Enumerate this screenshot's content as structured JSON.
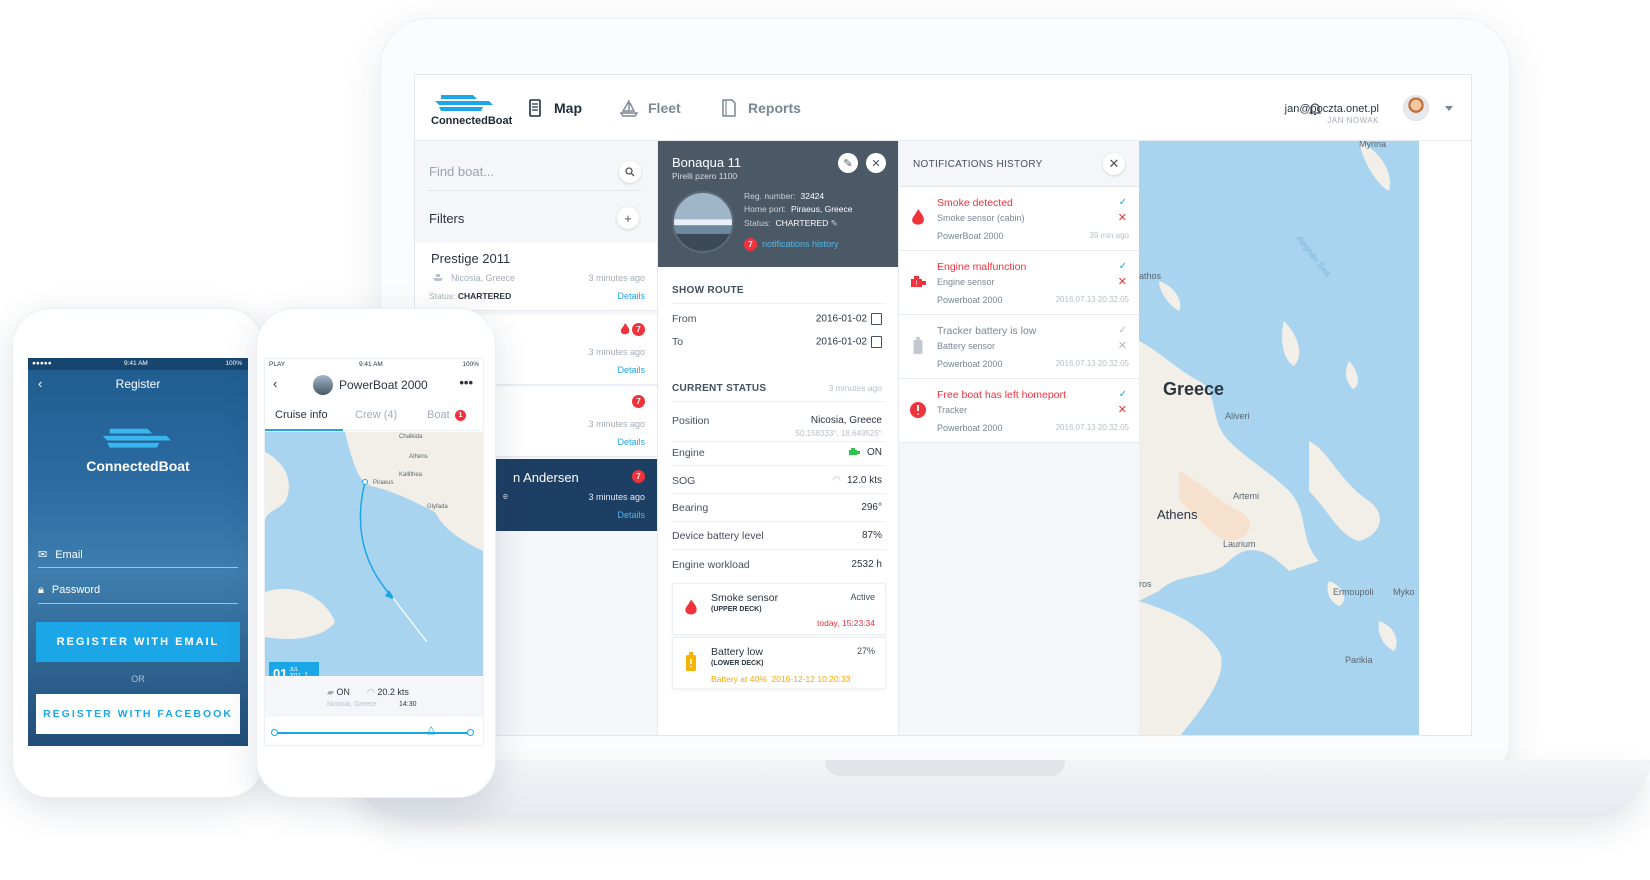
{
  "brand": {
    "name": "ConnectedBoat",
    "accent": "#1ba6e8",
    "alert": "#f0323c"
  },
  "topbar": {
    "nav": [
      {
        "label": "Map",
        "icon": "map-icon",
        "active": true
      },
      {
        "label": "Fleet",
        "icon": "sailboat-icon",
        "active": false
      },
      {
        "label": "Reports",
        "icon": "document-icon",
        "active": false
      }
    ],
    "user_email": "jan@poczta.onet.pl",
    "user_name": "JAN NOWAK"
  },
  "list": {
    "search_placeholder": "Find boat...",
    "filters_label": "Filters",
    "boats": [
      {
        "name": "Prestige 2011",
        "place": "Nicosia, Greece",
        "time": "3 minutes ago",
        "status_label": "Status:",
        "status": "CHARTERED",
        "details": "Details"
      },
      {
        "name": "",
        "place": "",
        "time": "3 minutes ago",
        "badge": "7",
        "details": "Details"
      },
      {
        "name": "",
        "place": "",
        "time": "3 minutes ago",
        "badge": "7",
        "details": "Details"
      },
      {
        "name": "n Andersen",
        "prefix": "e",
        "time": "3 minutes ago",
        "badge": "7",
        "details": "Details"
      }
    ]
  },
  "detail": {
    "title": "Bonaqua 11",
    "subtitle": "Pirelli pzero 1100",
    "reg_label": "Reg. number:",
    "reg": "32424",
    "port_label": "Home port:",
    "port": "Piraeus, Greece",
    "status_label": "Status:",
    "status": "CHARTERED",
    "notif_count": "7",
    "notif_link": "notifications history",
    "show_route": "SHOW ROUTE",
    "from_label": "From",
    "from": "2016-01-02",
    "to_label": "To",
    "to": "2016-01-02",
    "current_status": "CURRENT STATUS",
    "current_status_time": "3 minutes ago",
    "rows": [
      {
        "label": "Position",
        "value": "Nicosia, Greece",
        "sub": "50.158333°, 18.649525°"
      },
      {
        "label": "Engine",
        "value": "ON"
      },
      {
        "label": "SOG",
        "value": "12.0 kts"
      },
      {
        "label": "Bearing",
        "value": "296°"
      },
      {
        "label": "Device battery level",
        "value": "87%"
      },
      {
        "label": "Engine workload",
        "value": "2532 h"
      }
    ],
    "sensors": [
      {
        "title": "Smoke sensor",
        "sub": "(UPPER DECK)",
        "right": "Active",
        "date": "today, 15:23:34"
      },
      {
        "title": "Battery low",
        "sub": "(LOWER DECK)",
        "right": "27%",
        "note": "Battery at 40%",
        "date": "2016-12-12 10:20:33"
      }
    ]
  },
  "notifications": {
    "title": "NOTIFICATIONS HISTORY",
    "items": [
      {
        "title": "Smoke detected",
        "sub": "Smoke sensor (cabin)",
        "boat": "PowerBoat 2000",
        "time": "39 min ago",
        "alert": true
      },
      {
        "title": "Engine malfunction",
        "sub": "Engine sensor",
        "boat": "Powerboat 2000",
        "time": "2016.07.13 20:32:05",
        "alert": true
      },
      {
        "title": "Tracker battery is low",
        "sub": "Battery sensor",
        "boat": "Powerboat 2000",
        "time": "2016.07.13 20:32:05",
        "alert": false
      },
      {
        "title": "Free boat has left homeport",
        "sub": "Tracker",
        "boat": "Powerboat 2000",
        "time": "2016.07.13 20:32:05",
        "alert": true
      }
    ]
  },
  "map": {
    "labels": [
      "Myrina",
      "Aegean Sea",
      "athos",
      "Greece",
      "Aliveri",
      "Artemi",
      "Athens",
      "Laurium",
      "ros",
      "Ermoupoli",
      "Myko",
      "Parikia"
    ]
  },
  "phone_register": {
    "time": "9:41 AM",
    "battery": "100%",
    "title": "Register",
    "brand": "ConnectedBoat",
    "email_placeholder": "Email",
    "password_placeholder": "Password",
    "register_email": "REGISTER WITH EMAIL",
    "or": "OR",
    "register_facebook": "REGISTER WITH FACEBOOK"
  },
  "phone_cruise": {
    "carrier": "PLAY",
    "time": "9:41 AM",
    "battery": "100%",
    "title": "PowerBoat 2000",
    "tabs": [
      "Cruise info",
      "Crew (4)",
      "Boat"
    ],
    "boat_badge": "1",
    "date_day": "01",
    "date_month": "JUL",
    "date_year": "2017",
    "engine": "ON",
    "speed": "20.2 kts",
    "place": "Nicosia, Greece",
    "clock": "14:30",
    "map_labels": [
      "Chalkida",
      "Athens",
      "Kallithea",
      "Piraeus",
      "Glyfada"
    ]
  }
}
